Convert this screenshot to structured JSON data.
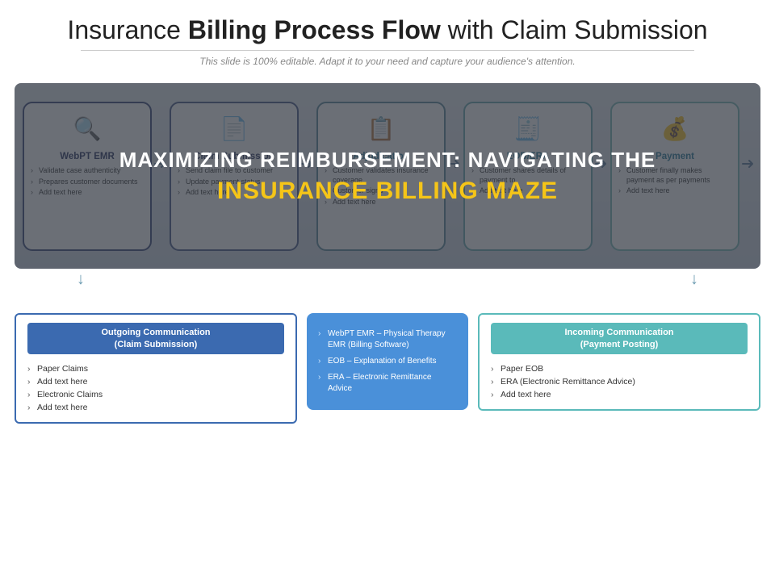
{
  "header": {
    "title_normal": "Insurance ",
    "title_bold": "Billing Process Flow",
    "title_end": " with Claim Submission",
    "subtitle": "This slide is 100% editable. Adapt it to your need and capture your audience's attention."
  },
  "overlay": {
    "line1": "MAXIMIZING REIMBURSEMENT: NAVIGATING THE",
    "line2": "INSURANCE BILLING MAZE"
  },
  "flow_cards": [
    {
      "id": "card-1",
      "icon": "🔍",
      "title": "WebPT EMR",
      "items": [
        "Validate case authenticity",
        "Prepares customer documents",
        "Add text here"
      ]
    },
    {
      "id": "card-2",
      "icon": "📄",
      "title": "Claim Submission",
      "items": [
        "Send claim file to customer",
        "Update payment status",
        "Add text here"
      ]
    },
    {
      "id": "card-3",
      "icon": "📋",
      "title": "Adjudication",
      "items": [
        "Customer validates insurance coverage",
        "Customer signs",
        "Add text here"
      ]
    },
    {
      "id": "card-4",
      "icon": "🧾",
      "title": "EOB/ERA",
      "items": [
        "Customer shares details of payment to",
        "Add text here"
      ]
    },
    {
      "id": "card-5",
      "icon": "💰",
      "title": "Payment",
      "items": [
        "Customer finally makes payment as per payments",
        "Add text here"
      ]
    }
  ],
  "outgoing_comm": {
    "title": "Outgoing Communication\n(Claim Submission)",
    "items": [
      "Paper Claims",
      "Add text here",
      "Electronic Claims",
      "Add text here"
    ]
  },
  "center_info": {
    "items": [
      "WebPT EMR – Physical Therapy EMR (Billing Software)",
      "EOB – Explanation of Benefits",
      "ERA – Electronic Remittance Advice"
    ]
  },
  "incoming_comm": {
    "title": "Incoming Communication\n(Payment Posting)",
    "items": [
      "Paper EOB",
      "ERA (Electronic Remittance Advice)",
      "Add text here"
    ]
  },
  "arrows": {
    "right": "→",
    "down": "↓"
  }
}
